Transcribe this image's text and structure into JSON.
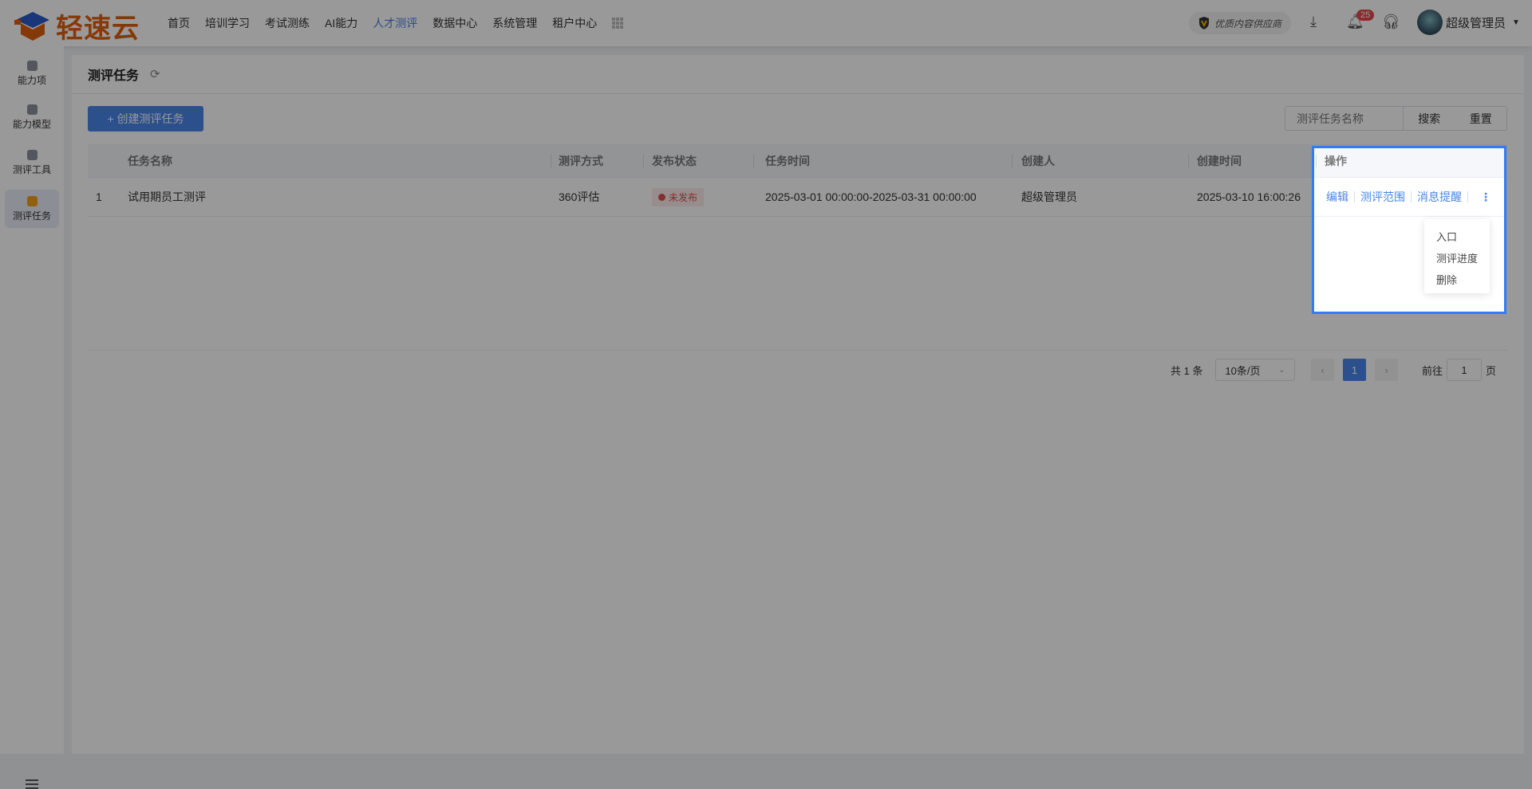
{
  "header": {
    "logo_text": "轻速云",
    "nav": [
      "首页",
      "培训学习",
      "考试测练",
      "AI能力",
      "人才测评",
      "数据中心",
      "系统管理",
      "租户中心"
    ],
    "active_nav": "人才测评",
    "supplier_badge": "优质内容供应商",
    "notification_count": "25",
    "user_name": "超级管理员"
  },
  "sidebar": {
    "items": [
      "能力项",
      "能力模型",
      "测评工具",
      "测评任务"
    ],
    "active": "测评任务"
  },
  "page": {
    "title": "测评任务",
    "create_button": "+ 创建测评任务",
    "search_placeholder": "测评任务名称",
    "search_button": "搜索",
    "reset_button": "重置"
  },
  "table": {
    "columns": [
      "任务名称",
      "测评方式",
      "发布状态",
      "任务时间",
      "创建人",
      "创建时间",
      "操作"
    ],
    "rows": [
      {
        "index": "1",
        "name": "试用期员工测评",
        "method": "360评估",
        "status": "未发布",
        "time": "2025-03-01 00:00:00-2025-03-31 00:00:00",
        "creator": "超级管理员",
        "created": "2025-03-10 16:00:26",
        "actions": [
          "编辑",
          "测评范围",
          "消息提醒"
        ]
      }
    ]
  },
  "more_menu": [
    "入口",
    "测评进度",
    "删除"
  ],
  "pagination": {
    "total": "共 1 条",
    "page_size": "10条/页",
    "current_page": "1",
    "goto_label": "前往",
    "goto_value": "1",
    "page_suffix": "页"
  },
  "colors": {
    "primary": "#4a86e8",
    "brand": "#e0600e",
    "danger": "#e04b4b",
    "highlight": "#2f7cf6"
  }
}
